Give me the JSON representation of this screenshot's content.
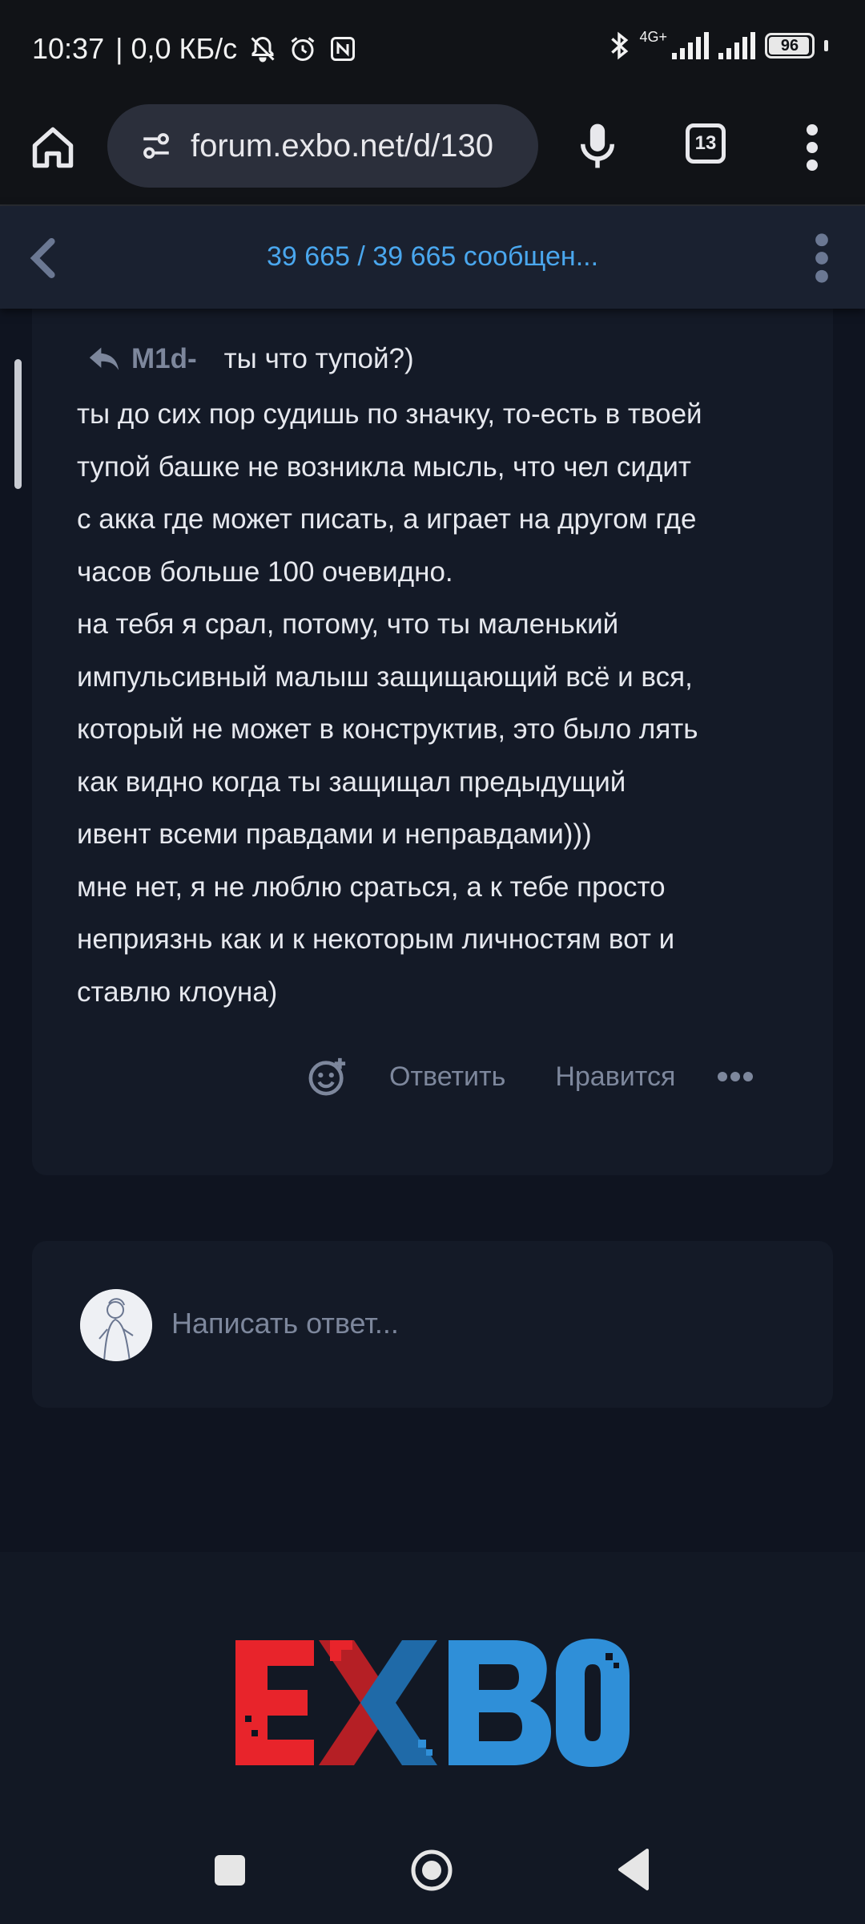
{
  "status_bar": {
    "time": "10:37",
    "speed": "| 0,0 КБ/с",
    "network_tag": "4G+",
    "battery": "96",
    "battery_level": 0.96
  },
  "browser": {
    "url": "forum.exbo.net/d/130",
    "tab_count": "13"
  },
  "forum_header": {
    "title": "39 665 / 39 665 сообщен..."
  },
  "post": {
    "reply_to_author": "M1d-",
    "reply_to_snippet": "ты что тупой?)",
    "body_lines": [
      "ты до сих пор судишь по значку, то-есть в твоей",
      "тупой башке не возникла мысль, что чел сидит",
      "с акка где может писать, а играет на другом где",
      "часов больше 100 очевидно.",
      "на тебя я срал, потому, что ты маленький",
      "импульсивный малыш защищающий всё и вся,",
      "который не может в конструктив, это было лять",
      "как видно когда ты защищал предыдущий",
      "ивент всеми правдами и неправдами)))",
      "мне нет, я не люблю сраться, а к тебе просто",
      "неприязнь как и к некоторым личностям вот и",
      "ставлю клоуна)"
    ],
    "actions": {
      "reply": "Ответить",
      "like": "Нравится"
    }
  },
  "composer": {
    "placeholder": "Написать ответ..."
  },
  "footer": {
    "logo_text": "EXBO",
    "colors": {
      "red": "#e8242b",
      "blue": "#2f8fd8"
    }
  },
  "icons": [
    "home-icon",
    "site-settings-icon",
    "mic-icon",
    "tabs-icon",
    "menu-icon",
    "back-chevron-icon",
    "kebab-icon",
    "reply-arrow-icon",
    "add-reaction-icon",
    "more-icon",
    "nav-recents-icon",
    "nav-home-icon",
    "nav-back-icon"
  ]
}
